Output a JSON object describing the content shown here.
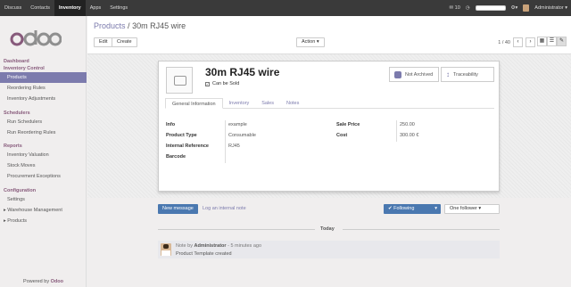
{
  "topbar": {
    "menu": [
      "Discuss",
      "Contacts",
      "Inventory",
      "Apps",
      "Settings"
    ],
    "active_index": 2,
    "chat_count": "10",
    "user": "Administrator"
  },
  "sidebar": {
    "logo": "odoo",
    "sections": [
      {
        "header": "Dashboard",
        "items": []
      },
      {
        "header": "Inventory Control",
        "items": [
          "Products",
          "Reordering Rules",
          "Inventory Adjustments"
        ]
      },
      {
        "header": "Schedulers",
        "items": [
          "Run Schedulers",
          "Run Reordering Rules"
        ]
      },
      {
        "header": "Reports",
        "items": [
          "Inventory Valuation",
          "Stock Moves",
          "Procurement Exceptions"
        ]
      },
      {
        "header": "Configuration",
        "items": [
          "Settings"
        ]
      }
    ],
    "expandable": [
      "Warehouse Management",
      "Products"
    ],
    "active_item": "Products",
    "powered_prefix": "Powered by",
    "powered_brand": "Odoo"
  },
  "control_panel": {
    "breadcrumb_parent": "Products",
    "breadcrumb_sep": "/",
    "breadcrumb_current": "30m RJ45 wire",
    "edit_label": "Edit",
    "create_label": "Create",
    "action_label": "Action",
    "pager": "1 / 40"
  },
  "form": {
    "name": "30m RJ45 wire",
    "can_be_sold_label": "Can be Sold",
    "can_be_sold": true,
    "stat_archive": "Not Archived",
    "stat_traceability": "Traceability",
    "tabs": [
      "General Information",
      "Inventory",
      "Sales",
      "Notes"
    ],
    "active_tab": 0,
    "fields_left": [
      {
        "label": "Info",
        "value": "example"
      },
      {
        "label": "Product Type",
        "value": "Consumable"
      },
      {
        "label": "Internal Reference",
        "value": "RJ45"
      },
      {
        "label": "Barcode",
        "value": ""
      }
    ],
    "fields_right": [
      {
        "label": "Sale Price",
        "value": "250.00"
      },
      {
        "label": "Cost",
        "value": "300.00 €"
      }
    ]
  },
  "chatter": {
    "new_message": "New message",
    "log_note": "Log an internal note",
    "following": "Following",
    "followers": "One follower",
    "today": "Today",
    "message": {
      "prefix": "Note by",
      "author": "Administrator",
      "time": "- 5 minutes ago",
      "body": "Product Template created"
    }
  }
}
